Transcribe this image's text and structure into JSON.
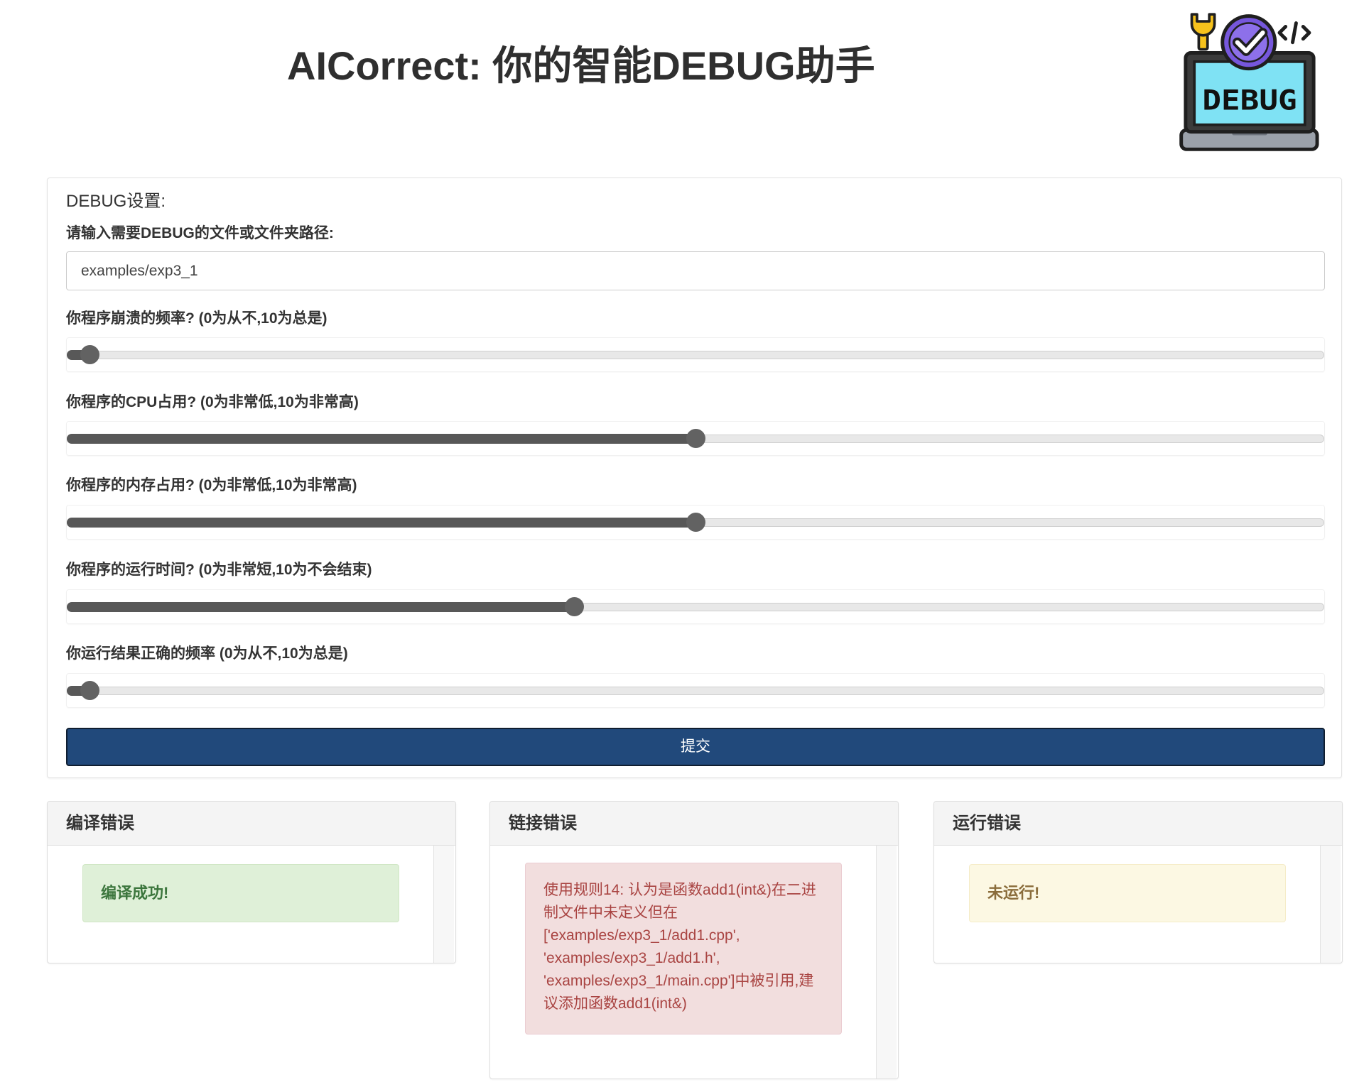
{
  "app": {
    "title": "AICorrect: 你的智能DEBUG助手"
  },
  "logo": {
    "icon": "debug-laptop-icon",
    "text": "DEBUG"
  },
  "settings": {
    "heading": "DEBUG设置:",
    "path_label": "请输入需要DEBUG的文件或文件夹路径:",
    "path_value": "examples/exp3_1",
    "sliders": [
      {
        "label": "你程序崩溃的频率? (0为从不,10为总是)",
        "value": 0,
        "min": 0,
        "max": 10
      },
      {
        "label": "你程序的CPU占用? (0为非常低,10为非常高)",
        "value": 5,
        "min": 0,
        "max": 10
      },
      {
        "label": "你程序的内存占用? (0为非常低,10为非常高)",
        "value": 5,
        "min": 0,
        "max": 10
      },
      {
        "label": "你程序的运行时间? (0为非常短,10为不会结束)",
        "value": 4,
        "min": 0,
        "max": 10
      },
      {
        "label": "你运行结果正确的频率 (0为从不,10为总是)",
        "value": 0,
        "min": 0,
        "max": 10
      }
    ],
    "submit_label": "提交"
  },
  "results": [
    {
      "title": "编译错误",
      "status": "success",
      "message": "编译成功!"
    },
    {
      "title": "链接错误",
      "status": "danger",
      "message": "使用规则14: 认为是函数add1(int&)在二进制文件中未定义但在['examples/exp3_1/add1.cpp', 'examples/exp3_1/add1.h', 'examples/exp3_1/main.cpp']中被引用,建议添加函数add1(int&)"
    },
    {
      "title": "运行错误",
      "status": "warning",
      "message": "未运行!"
    }
  ],
  "colors": {
    "primary": "#21497b",
    "success_bg": "#dff0d8",
    "success_text": "#3c763d",
    "success_border": "#d0e6c4",
    "danger_bg": "#f2dede",
    "danger_text": "#a94442",
    "danger_border": "#ebccd1",
    "warning_bg": "#fcf8e3",
    "warning_text": "#8a6d3b",
    "warning_border": "#f5ecc8"
  }
}
